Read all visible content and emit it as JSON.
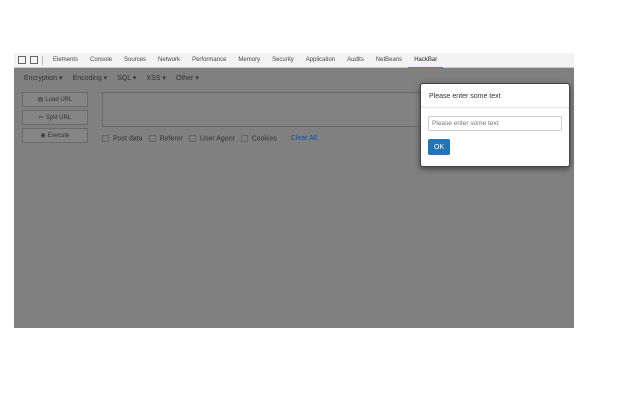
{
  "devtools": {
    "tabs": [
      "Elements",
      "Console",
      "Sources",
      "Network",
      "Performance",
      "Memory",
      "Security",
      "Application",
      "Audits",
      "NetBeans",
      "HackBar"
    ],
    "active_tab": "HackBar"
  },
  "hackbar": {
    "menu": [
      "Encryption ▾",
      "Encoding ▾",
      "SQL ▾",
      "XSS ▾",
      "Other ▾"
    ],
    "buttons": {
      "load": "Load URL",
      "split": "Split URL",
      "execute": "Execute"
    },
    "checks": [
      "Post data",
      "Referer",
      "User Agent",
      "Cookies"
    ],
    "clear_all": "Clear All"
  },
  "modal": {
    "title": "Please enter some text",
    "placeholder": "Please enter some text",
    "ok": "OK"
  }
}
